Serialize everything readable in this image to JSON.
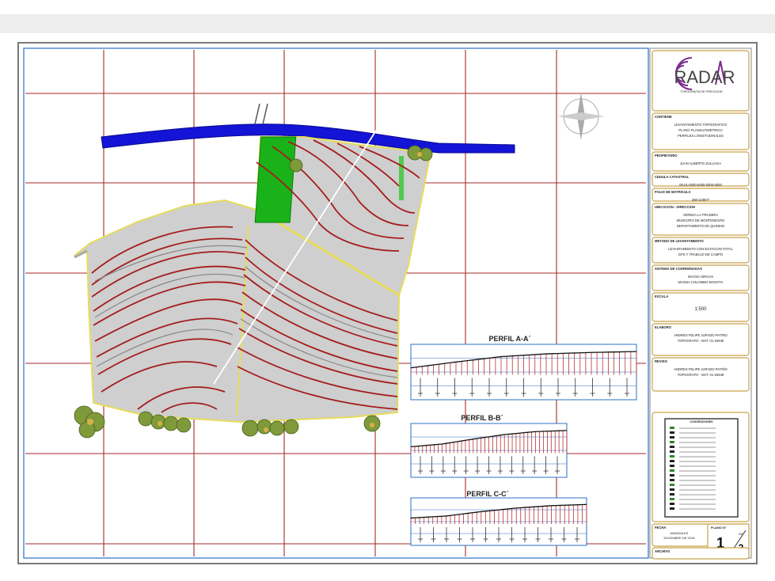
{
  "logo": {
    "name": "RADAR",
    "tagline": "TOPOGRAFIA DE PRECISION"
  },
  "title_block": {
    "contiene": {
      "label": "CONTIENE",
      "lines": [
        "LEVANTAMIENTO TOPOGRAFICO",
        "PLANO PLANIALTIMETRICO",
        "PERFILES LONGITUDINALES"
      ]
    },
    "propietario": {
      "label": "PROPIETARIO",
      "value": "JUAN ALBERTO ZULUAGA"
    },
    "cedula": {
      "label": "CEDULA CATASTRAL",
      "value": "00-01-0000-0000-0000-0000"
    },
    "folio": {
      "label": "FOLIO DE MATRICULA",
      "value": "280-119877"
    },
    "ubicacion": {
      "label": "UBICACION - DIRECCION",
      "lines": [
        "VEREDA LA PRADERA",
        "MUNICIPIO DE MONTENEGRO",
        "DEPARTAMENTO DE QUINDIO"
      ]
    },
    "metodo": {
      "label": "METODO DE LEVANTAMIENTO",
      "lines": [
        "LEVANTAMIENTO CON ESTACION TOTAL",
        "GPS Y TRABAJO DE CAMPO"
      ]
    },
    "sistema": {
      "label": "SISTEMA DE COORDENADAS",
      "lines": [
        "MAGNA SIRGAS",
        "MAGNA COLOMBIA BOGOTA"
      ]
    },
    "escala": {
      "label": "ESCALA",
      "value": "1:500"
    },
    "elaboro": {
      "label": "ELABORO",
      "lines": [
        "ANDRES FELIPE JURADO PATIÑO",
        "TOPOGRAFO - MAT. 01-15949"
      ]
    },
    "reviso": {
      "label": "REVISO",
      "lines": [
        "ANDRES FELIPE JURADO PATIÑO",
        "TOPOGRAFO - MAT. 01-15949"
      ]
    },
    "convenciones": {
      "label": "CONVENCIONES"
    },
    "fecha": {
      "label": "FECHA",
      "lines": [
        "MANIZALES",
        "DICIEMBRE DE 2018"
      ]
    },
    "archivo": {
      "label": "ARCHIVO"
    },
    "plano": {
      "label": "PLANO N°",
      "number": "1",
      "de_label": "DE",
      "total": "2"
    }
  },
  "profiles": [
    {
      "title": "PERFIL A-A´"
    },
    {
      "title": "PERFIL B-B´"
    },
    {
      "title": "PERFIL C-C´"
    }
  ],
  "colors": {
    "road": "#1414d6",
    "parcel_fill": "#cfcfcf",
    "parcel_border": "#e6dc5a",
    "contour": "#a51c1c",
    "grid": "#a52a2a",
    "green_zone": "#19b319",
    "title_block_border": "#c9a24a"
  }
}
